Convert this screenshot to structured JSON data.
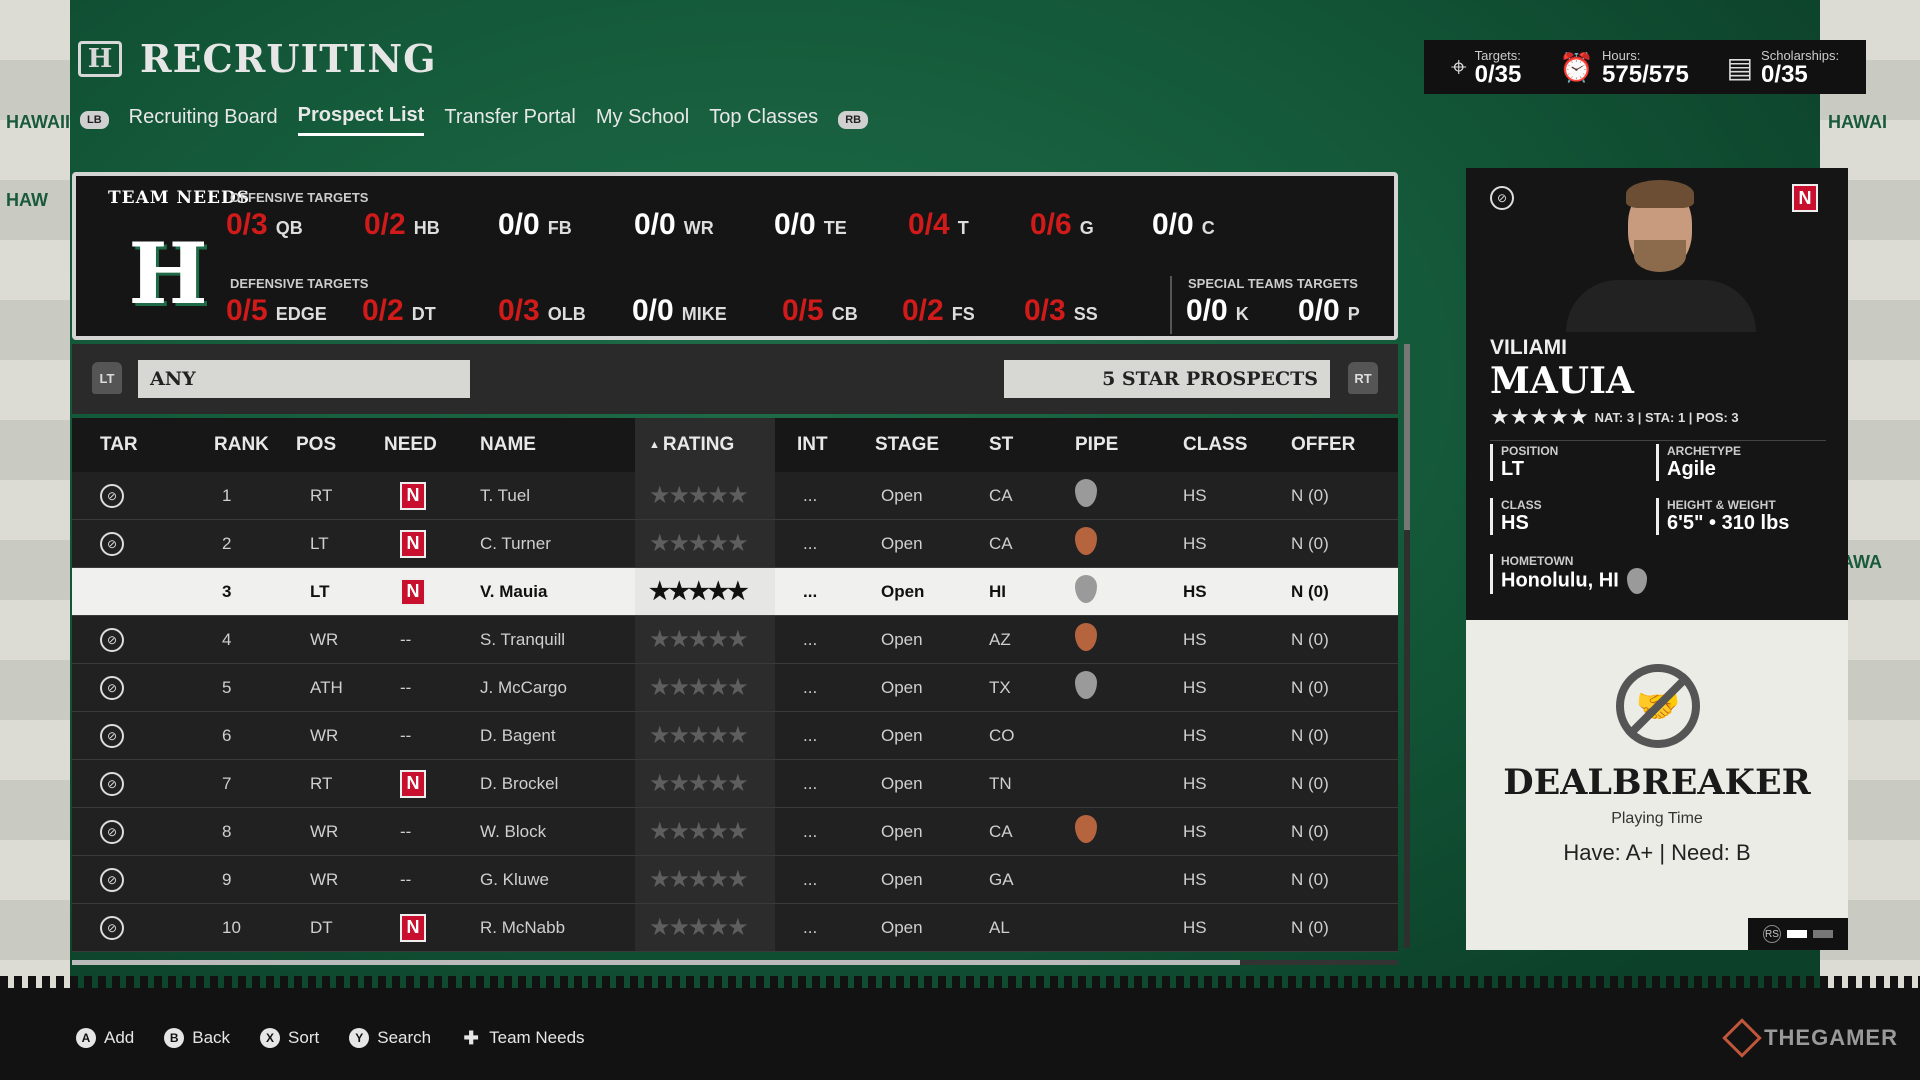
{
  "header": {
    "title": "RECRUITING",
    "tabs": [
      "Recruiting Board",
      "Prospect List",
      "Transfer Portal",
      "My School",
      "Top Classes"
    ],
    "active_tab": "Prospect List",
    "left_bumper": "LB",
    "right_bumper": "RB"
  },
  "stats": {
    "targets_label": "Targets:",
    "targets_value": "0/35",
    "hours_label": "Hours:",
    "hours_value": "575/575",
    "scholarships_label": "Scholarships:",
    "scholarships_value": "0/35"
  },
  "team_needs": {
    "title": "TEAM NEEDS",
    "offensive_label": "OFFENSIVE TARGETS",
    "defensive_label": "DEFENSIVE TARGETS",
    "special_label": "SPECIAL TEAMS TARGETS",
    "offensive": [
      {
        "value": "0/3",
        "pos": "QB",
        "red": true
      },
      {
        "value": "0/2",
        "pos": "HB",
        "red": true
      },
      {
        "value": "0/0",
        "pos": "FB",
        "red": false
      },
      {
        "value": "0/0",
        "pos": "WR",
        "red": false
      },
      {
        "value": "0/0",
        "pos": "TE",
        "red": false
      },
      {
        "value": "0/4",
        "pos": "T",
        "red": true
      },
      {
        "value": "0/6",
        "pos": "G",
        "red": true
      },
      {
        "value": "0/0",
        "pos": "C",
        "red": false
      }
    ],
    "defensive": [
      {
        "value": "0/5",
        "pos": "EDGE",
        "red": true
      },
      {
        "value": "0/2",
        "pos": "DT",
        "red": true
      },
      {
        "value": "0/3",
        "pos": "OLB",
        "red": true
      },
      {
        "value": "0/0",
        "pos": "MIKE",
        "red": false
      },
      {
        "value": "0/5",
        "pos": "CB",
        "red": true
      },
      {
        "value": "0/2",
        "pos": "FS",
        "red": true
      },
      {
        "value": "0/3",
        "pos": "SS",
        "red": true
      }
    ],
    "special": [
      {
        "value": "0/0",
        "pos": "K",
        "red": false
      },
      {
        "value": "0/0",
        "pos": "P",
        "red": false
      }
    ]
  },
  "filters": {
    "left_trigger": "LT",
    "right_trigger": "RT",
    "position_filter": "ANY",
    "prospect_filter": "5 STAR PROSPECTS"
  },
  "table": {
    "columns": [
      "TAR",
      "RANK",
      "POS",
      "NEED",
      "NAME",
      "RATING",
      "INT",
      "STAGE",
      "ST",
      "PIPE",
      "CLASS",
      "OFFER"
    ],
    "rows": [
      {
        "rank": "1",
        "pos": "RT",
        "need": "N",
        "name": "T. Tuel",
        "stars": 5,
        "int": "...",
        "stage": "Open",
        "st": "CA",
        "pipe": "silver",
        "class": "HS",
        "offer": "N (0)"
      },
      {
        "rank": "2",
        "pos": "LT",
        "need": "N",
        "name": "C. Turner",
        "stars": 5,
        "int": "...",
        "stage": "Open",
        "st": "CA",
        "pipe": "bronze",
        "class": "HS",
        "offer": "N (0)"
      },
      {
        "rank": "3",
        "pos": "LT",
        "need": "N",
        "name": "V. Mauia",
        "stars": 5,
        "int": "...",
        "stage": "Open",
        "st": "HI",
        "pipe": "silver",
        "class": "HS",
        "offer": "N (0)",
        "selected": true
      },
      {
        "rank": "4",
        "pos": "WR",
        "need": "--",
        "name": "S. Tranquill",
        "stars": 5,
        "int": "...",
        "stage": "Open",
        "st": "AZ",
        "pipe": "bronze",
        "class": "HS",
        "offer": "N (0)"
      },
      {
        "rank": "5",
        "pos": "ATH",
        "need": "--",
        "name": "J. McCargo",
        "stars": 5,
        "int": "...",
        "stage": "Open",
        "st": "TX",
        "pipe": "silver",
        "class": "HS",
        "offer": "N (0)"
      },
      {
        "rank": "6",
        "pos": "WR",
        "need": "--",
        "name": "D. Bagent",
        "stars": 5,
        "int": "...",
        "stage": "Open",
        "st": "CO",
        "pipe": "",
        "class": "HS",
        "offer": "N (0)"
      },
      {
        "rank": "7",
        "pos": "RT",
        "need": "N",
        "name": "D. Brockel",
        "stars": 5,
        "int": "...",
        "stage": "Open",
        "st": "TN",
        "pipe": "",
        "class": "HS",
        "offer": "N (0)"
      },
      {
        "rank": "8",
        "pos": "WR",
        "need": "--",
        "name": "W. Block",
        "stars": 5,
        "int": "...",
        "stage": "Open",
        "st": "CA",
        "pipe": "bronze",
        "class": "HS",
        "offer": "N (0)"
      },
      {
        "rank": "9",
        "pos": "WR",
        "need": "--",
        "name": "G. Kluwe",
        "stars": 5,
        "int": "...",
        "stage": "Open",
        "st": "GA",
        "pipe": "",
        "class": "HS",
        "offer": "N (0)"
      },
      {
        "rank": "10",
        "pos": "DT",
        "need": "N",
        "name": "R. McNabb",
        "stars": 5,
        "int": "...",
        "stage": "Open",
        "st": "AL",
        "pipe": "",
        "class": "HS",
        "offer": "N (0)"
      }
    ]
  },
  "player_card": {
    "first_name": "VILIAMI",
    "last_name": "MAUIA",
    "stars_display": "★★★★★",
    "meta": "NAT: 3 | STA: 1 | POS: 3",
    "need_badge": "N",
    "position_label": "POSITION",
    "position_value": "LT",
    "archetype_label": "ARCHETYPE",
    "archetype_value": "Agile",
    "class_label": "CLASS",
    "class_value": "HS",
    "hw_label": "HEIGHT & WEIGHT",
    "hw_value": "6'5\" • 310 lbs",
    "hometown_label": "HOMETOWN",
    "hometown_value": "Honolulu, HI",
    "dealbreaker_title": "DEALBREAKER",
    "dealbreaker_sub": "Playing Time",
    "dealbreaker_have": "Have: A+ | Need: B",
    "tab_button": "RS"
  },
  "footer": {
    "hints": [
      {
        "glyph": "A",
        "label": "Add"
      },
      {
        "glyph": "B",
        "label": "Back"
      },
      {
        "glyph": "X",
        "label": "Sort"
      },
      {
        "glyph": "Y",
        "label": "Search"
      },
      {
        "glyph": "✚",
        "label": "Team Needs"
      }
    ],
    "watermark": "THEGAMER"
  },
  "wall_text": [
    "HAWAII",
    "HAWAI",
    "HAW",
    "HAWA"
  ],
  "colors": {
    "accent_red": "#d11a1a",
    "need_badge": "#c8102e",
    "field_green": "#145a3a"
  }
}
